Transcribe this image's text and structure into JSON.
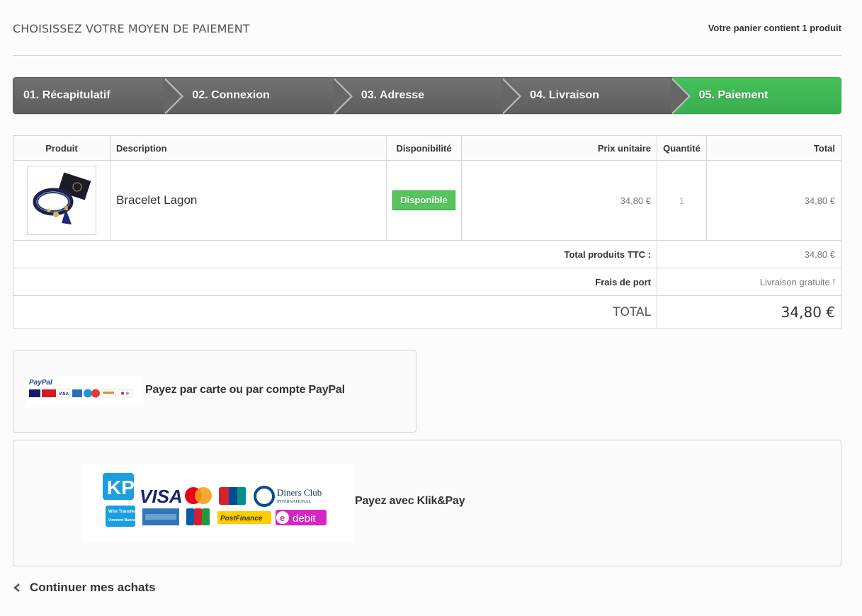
{
  "header": {
    "title": "CHOISISSEZ VOTRE MOYEN DE PAIEMENT",
    "cart_summary": "Votre panier contient 1 produit"
  },
  "steps": [
    {
      "label": "01. Récapitulatif",
      "current": false
    },
    {
      "label": "02. Connexion",
      "current": false
    },
    {
      "label": "03. Adresse",
      "current": false
    },
    {
      "label": "04. Livraison",
      "current": false
    },
    {
      "label": "05. Paiement",
      "current": true
    }
  ],
  "colors": {
    "step_inactive": "#676666",
    "step_current": "#41b755",
    "badge_available": "#55c65e"
  },
  "cart": {
    "columns": {
      "product": "Produit",
      "description": "Description",
      "availability": "Disponibilité",
      "unit_price": "Prix unitaire",
      "quantity": "Quantité",
      "total": "Total"
    },
    "items": [
      {
        "name": "Bracelet Lagon",
        "availability": "Disponible",
        "unit_price": "34,80 €",
        "quantity": "1",
        "total": "34,80 €"
      }
    ],
    "summary": {
      "products_label": "Total produits TTC :",
      "products_value": "34,80 €",
      "shipping_label": "Frais de port",
      "shipping_value": "Livraison gratuite !",
      "total_label": "TOTAL",
      "total_value": "34,80 €"
    }
  },
  "payments": {
    "paypal": {
      "label": "Payez par carte ou par compte PayPal",
      "logo_text": "PayPal"
    },
    "klikpay": {
      "label": "Payez avec Klik&Pay",
      "logo_texts": {
        "visa": "VISA",
        "diners": "Diners Club",
        "diners_sub": "INTERNATIONAL",
        "wire": "Wire Transfer",
        "virement": "Virement Bancaire",
        "postfinance": "PostFinance",
        "edebit": "debit"
      }
    }
  },
  "nav": {
    "continue_label": "Continuer mes achats"
  }
}
